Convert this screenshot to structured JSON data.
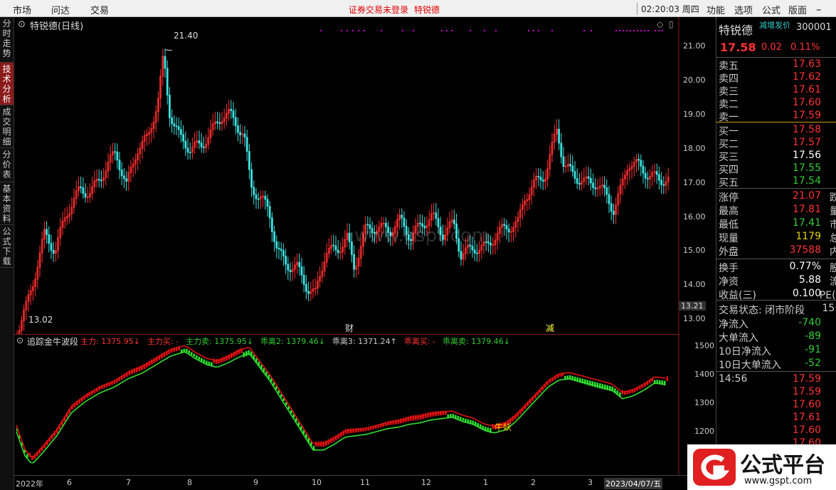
{
  "menu": {
    "items": [
      "市场",
      "问达",
      "交易"
    ],
    "center_notice": "证券交易未登录",
    "center_name": "特锐德",
    "clock": "02:20:03 周四",
    "right_items": [
      "功能",
      "选项",
      "公式",
      "版面"
    ]
  },
  "left_tabs": [
    "分时走势",
    "技术分析",
    "成交明细",
    "分价表",
    "基本资料",
    "公式下载"
  ],
  "main_chart": {
    "title": "特锐德(日线)",
    "high_label": "21.40",
    "low_label": "13.02",
    "y_ticks": [
      "21.00",
      "20.00",
      "19.00",
      "18.00",
      "17.00",
      "16.00",
      "15.00",
      "14.00",
      "13.00"
    ],
    "y_tick_values": [
      21,
      20,
      19,
      18,
      17,
      16,
      15,
      14,
      13
    ],
    "cursor_price": "13.21",
    "markers": [
      "财",
      "减"
    ],
    "watermark": "www.gspt.com"
  },
  "sub_chart": {
    "title": "追踪金牛波段",
    "legend": [
      {
        "text": "主力: 1375.95↓",
        "color": "#ff3333"
      },
      {
        "text": "主力买: -",
        "color": "#ff3333"
      },
      {
        "text": "主力卖: 1375.95↓",
        "color": "#33cc33"
      },
      {
        "text": "乖离2: 1379.46↓",
        "color": "#33cc33"
      },
      {
        "text": "乖离3: 1371.24↑",
        "color": "#cccccc"
      },
      {
        "text": "乖离买: -",
        "color": "#ff3333"
      },
      {
        "text": "乖离卖: 1379.46↓",
        "color": "#33cc33"
      }
    ],
    "y_ticks": [
      "1500",
      "1400",
      "1300",
      "1200"
    ],
    "y_tick_values": [
      1500,
      1400,
      1300,
      1200
    ],
    "annotation": "牛妖"
  },
  "x_axis": [
    "2022年",
    "6",
    "7",
    "8",
    "9",
    "10",
    "11",
    "12",
    "1",
    "2",
    "3",
    "2023/04/07/五"
  ],
  "quote": {
    "name": "特锐德",
    "code": "300001",
    "tag": "减增发价",
    "price": "17.58",
    "change": "0.02",
    "pct": "0.11%",
    "asks": [
      {
        "k": "卖五",
        "v": "17.63"
      },
      {
        "k": "卖四",
        "v": "17.62"
      },
      {
        "k": "卖三",
        "v": "17.61"
      },
      {
        "k": "卖二",
        "v": "17.60"
      },
      {
        "k": "卖一",
        "v": "17.59"
      }
    ],
    "bids": [
      {
        "k": "买一",
        "v": "17.58"
      },
      {
        "k": "买二",
        "v": "17.57"
      },
      {
        "k": "买三",
        "v": "17.56"
      },
      {
        "k": "买四",
        "v": "17.55"
      },
      {
        "k": "买五",
        "v": "17.54"
      }
    ],
    "stats": [
      {
        "k": "涨停",
        "v": "21.07",
        "x": "跌停",
        "c": "red"
      },
      {
        "k": "最高",
        "v": "17.81",
        "x": "量比",
        "c": "red"
      },
      {
        "k": "最低",
        "v": "17.41",
        "x": "市值",
        "c": "green"
      },
      {
        "k": "现量",
        "v": "1179",
        "x": "总量",
        "c": "yellow"
      },
      {
        "k": "外盘",
        "v": "37588",
        "x": "内盘",
        "c": "red"
      }
    ],
    "stats2": [
      {
        "k": "换手",
        "v": "0.77%",
        "x": "股本",
        "c": "white"
      },
      {
        "k": "净资",
        "v": "5.88",
        "x": "流通",
        "c": "white"
      },
      {
        "k": "收益(三)",
        "v": "0.100",
        "x": "PE(动)",
        "c": "white"
      }
    ],
    "status_label": "交易状态: 闭市阶段",
    "status_time": "15:",
    "flows": [
      {
        "k": "净流入",
        "v": "-740"
      },
      {
        "k": "大单流入",
        "v": "-89"
      },
      {
        "k": "10日净流入",
        "v": "-91"
      },
      {
        "k": "10日大单流入",
        "v": "-52"
      }
    ],
    "ticks": [
      {
        "t": "14:56",
        "v": "17.59"
      },
      {
        "t": "",
        "v": "17.59"
      },
      {
        "t": "",
        "v": "17.60"
      },
      {
        "t": "",
        "v": "17.61"
      },
      {
        "t": "",
        "v": "17.60"
      },
      {
        "t": "",
        "v": "17.60"
      }
    ]
  },
  "brand": {
    "name": "公式平台",
    "url": "www.gspt.com"
  }
}
